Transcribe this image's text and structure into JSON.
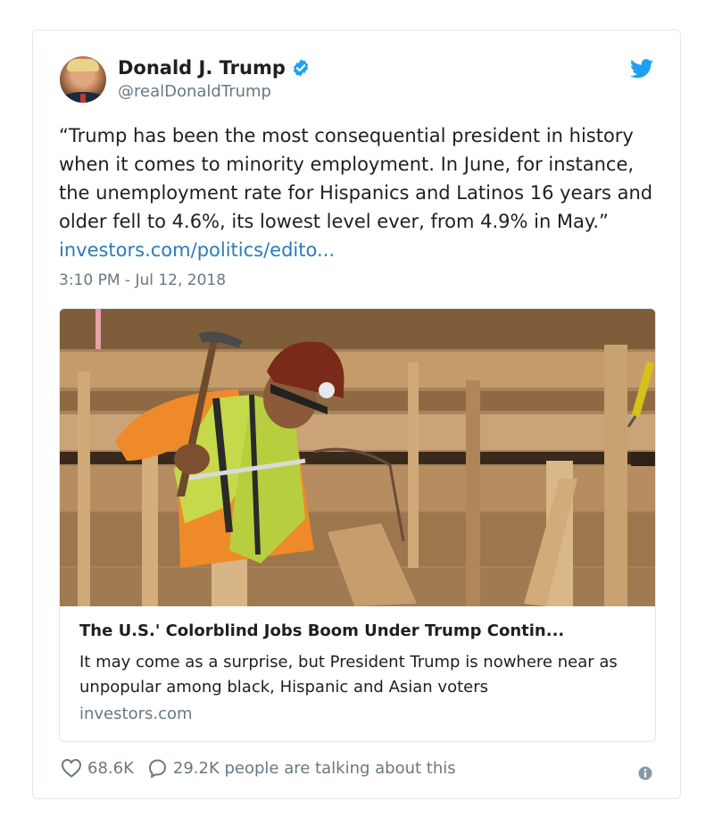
{
  "tweet": {
    "author_name": "Donald J. Trump",
    "handle": "@realDonaldTrump",
    "text": "“Trump has been the most consequential president in history when it comes to minority employment. In June, for instance, the unemployment rate for Hispanics and Latinos 16 years and older fell to 4.6%, its lowest level ever, from 4.9% in May.” ",
    "link_text": "investors.com/politics/edito...",
    "timestamp": "3:10 PM - Jul 12, 2018"
  },
  "card": {
    "title": "The U.S.' Colorblind Jobs Boom Under Trump Contin...",
    "description": "It may come as a surprise, but President Trump is nowhere near as unpopular among black, Hispanic and Asian voters",
    "domain": "investors.com"
  },
  "actions": {
    "likes": "68.6K",
    "conversation": "29.2K people are talking about this"
  },
  "icons": {
    "verified": "verified-badge-icon",
    "bird": "twitter-bird-icon",
    "heart": "heart-icon",
    "reply": "speech-bubble-icon",
    "info": "info-icon"
  },
  "colors": {
    "link": "#2b7bb9",
    "verified": "#1da1f2",
    "muted": "#697882",
    "border": "#e1e8ed"
  }
}
